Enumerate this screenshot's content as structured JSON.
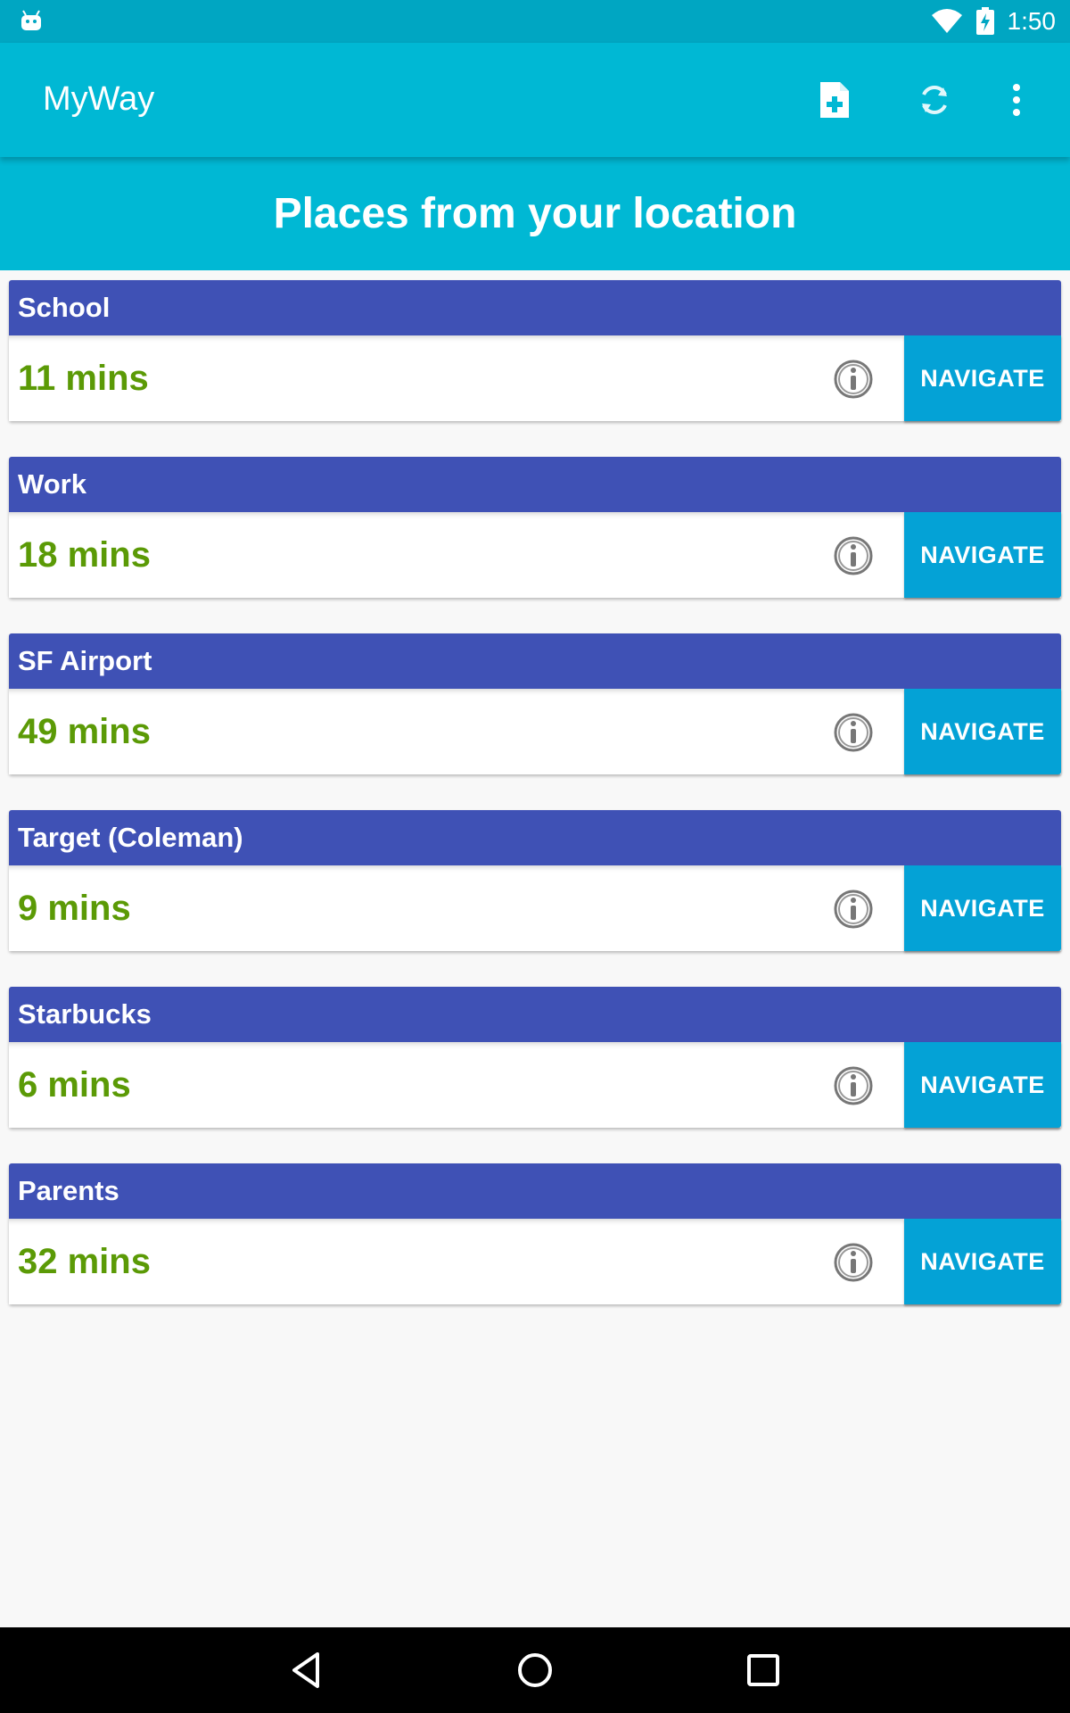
{
  "status_bar": {
    "time": "1:50",
    "icons": [
      "android-notification-icon",
      "wifi-icon",
      "battery-charging-icon"
    ]
  },
  "app_bar": {
    "title": "MyWay",
    "actions": [
      "add-document-icon",
      "refresh-icon",
      "more-vertical-icon"
    ]
  },
  "header": {
    "title": "Places from your location"
  },
  "places": [
    {
      "name": "School",
      "duration": "11 mins",
      "button": "NAVIGATE"
    },
    {
      "name": "Work",
      "duration": "18 mins",
      "button": "NAVIGATE"
    },
    {
      "name": "SF Airport",
      "duration": "49 mins",
      "button": "NAVIGATE"
    },
    {
      "name": "Target (Coleman)",
      "duration": "9 mins",
      "button": "NAVIGATE"
    },
    {
      "name": "Starbucks",
      "duration": "6 mins",
      "button": "NAVIGATE"
    },
    {
      "name": "Parents",
      "duration": "32 mins",
      "button": "NAVIGATE"
    }
  ],
  "colors": {
    "status_bar": "#00a6c2",
    "app_bar": "#00b8d4",
    "card_header": "#3f51b5",
    "navigate_button": "#04a2d6",
    "duration_text": "#5b9a06"
  },
  "system_nav": [
    "back-icon",
    "home-icon",
    "recents-icon"
  ]
}
